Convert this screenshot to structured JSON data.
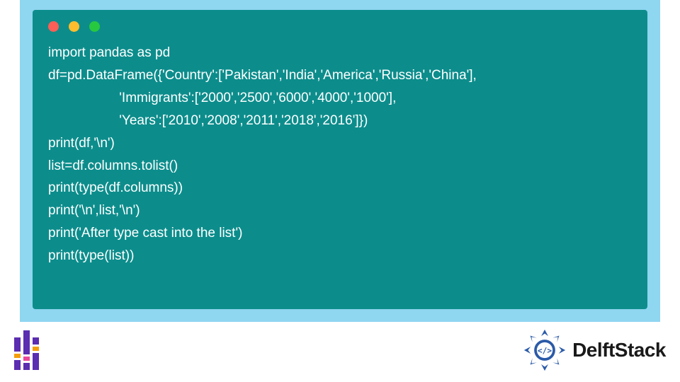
{
  "code": {
    "lines": [
      "import pandas as pd",
      "df=pd.DataFrame({'Country':['Pakistan','India','America','Russia','China'],",
      "                   'Immigrants':['2000','2500','6000','4000','1000'],",
      "                   'Years':['2010','2008','2011','2018','2016']})",
      "print(df,'\\n')",
      "list=df.columns.tolist()",
      "print(type(df.columns))",
      "print('\\n',list,'\\n')",
      "print('After type cast into the list')",
      "print(type(list))"
    ]
  },
  "brand": {
    "name": "DelftStack"
  },
  "colors": {
    "panel_bg": "#8fd6f0",
    "code_bg": "#0c8d8c",
    "code_fg": "#ffffff",
    "seal": "#2b5aa8",
    "bar_purple": "#5b2db0",
    "bar_orange": "#f59e0b",
    "bar_pink": "#ec4899"
  }
}
